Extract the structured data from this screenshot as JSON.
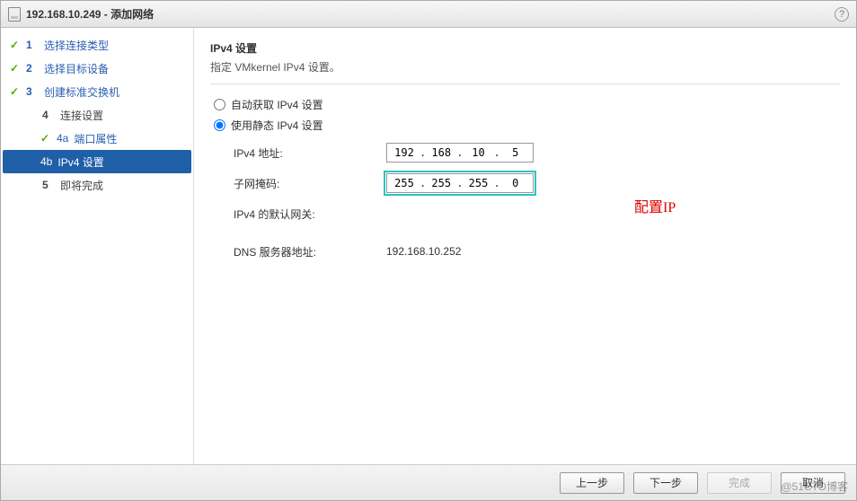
{
  "titlebar": {
    "title": "192.168.10.249 - 添加网络"
  },
  "sidebar": {
    "steps": [
      {
        "num": "1",
        "label": "选择连接类型",
        "done": true
      },
      {
        "num": "2",
        "label": "选择目标设备",
        "done": true
      },
      {
        "num": "3",
        "label": "创建标准交换机",
        "done": true
      },
      {
        "num": "4",
        "label": "连接设置",
        "done": false
      },
      {
        "sub": "4a",
        "label": "端口属性",
        "done": true
      },
      {
        "sub": "4b",
        "label": "IPv4 设置",
        "active": true
      },
      {
        "num": "5",
        "label": "即将完成",
        "done": false
      }
    ]
  },
  "content": {
    "title": "IPv4 设置",
    "desc": "指定 VMkernel IPv4 设置。",
    "radio_auto": "自动获取 IPv4 设置",
    "radio_static": "使用静态 IPv4 设置",
    "labels": {
      "ip": "IPv4 地址:",
      "mask": "子网掩码:",
      "gateway": "IPv4 的默认网关:",
      "dns": "DNS 服务器地址:"
    },
    "values": {
      "ip": [
        "192",
        "168",
        "10",
        "5"
      ],
      "mask": [
        "255",
        "255",
        "255",
        "0"
      ],
      "gateway": "",
      "dns": "192.168.10.252"
    },
    "annotation": "配置IP"
  },
  "footer": {
    "back": "上一步",
    "next": "下一步",
    "finish": "完成",
    "cancel": "取消"
  },
  "watermark": "@51CTO博客"
}
